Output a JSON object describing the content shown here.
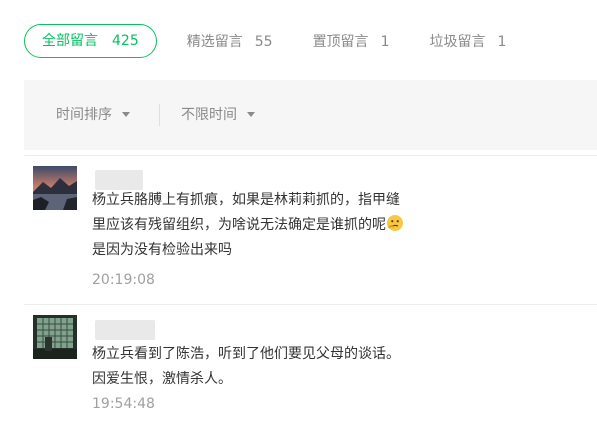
{
  "tabs": [
    {
      "label": "全部留言",
      "count": "425",
      "active": true
    },
    {
      "label": "精选留言",
      "count": "55"
    },
    {
      "label": "置顶留言",
      "count": "1"
    },
    {
      "label": "垃圾留言",
      "count": "1"
    }
  ],
  "filters": {
    "sort_label": "时间排序",
    "time_label": "不限时间"
  },
  "comments": [
    {
      "text_part1": "杨立兵胳膊上有抓痕，如果是林莉莉抓的，指甲缝里应该有残留组织，为啥说无法确定是谁抓的呢",
      "emoji": "thinking-face-emoji",
      "text_part2": "是因为没有检验出来吗",
      "time": "20:19:08"
    },
    {
      "text_part1": "杨立兵看到了陈浩，听到了他们要见父母的谈话。因爱生恨，激情杀人。",
      "time": "19:54:48"
    }
  ],
  "colors": {
    "accent": "#07c160",
    "muted": "#8a8a8a",
    "filter_bg": "#f6f6f6"
  }
}
